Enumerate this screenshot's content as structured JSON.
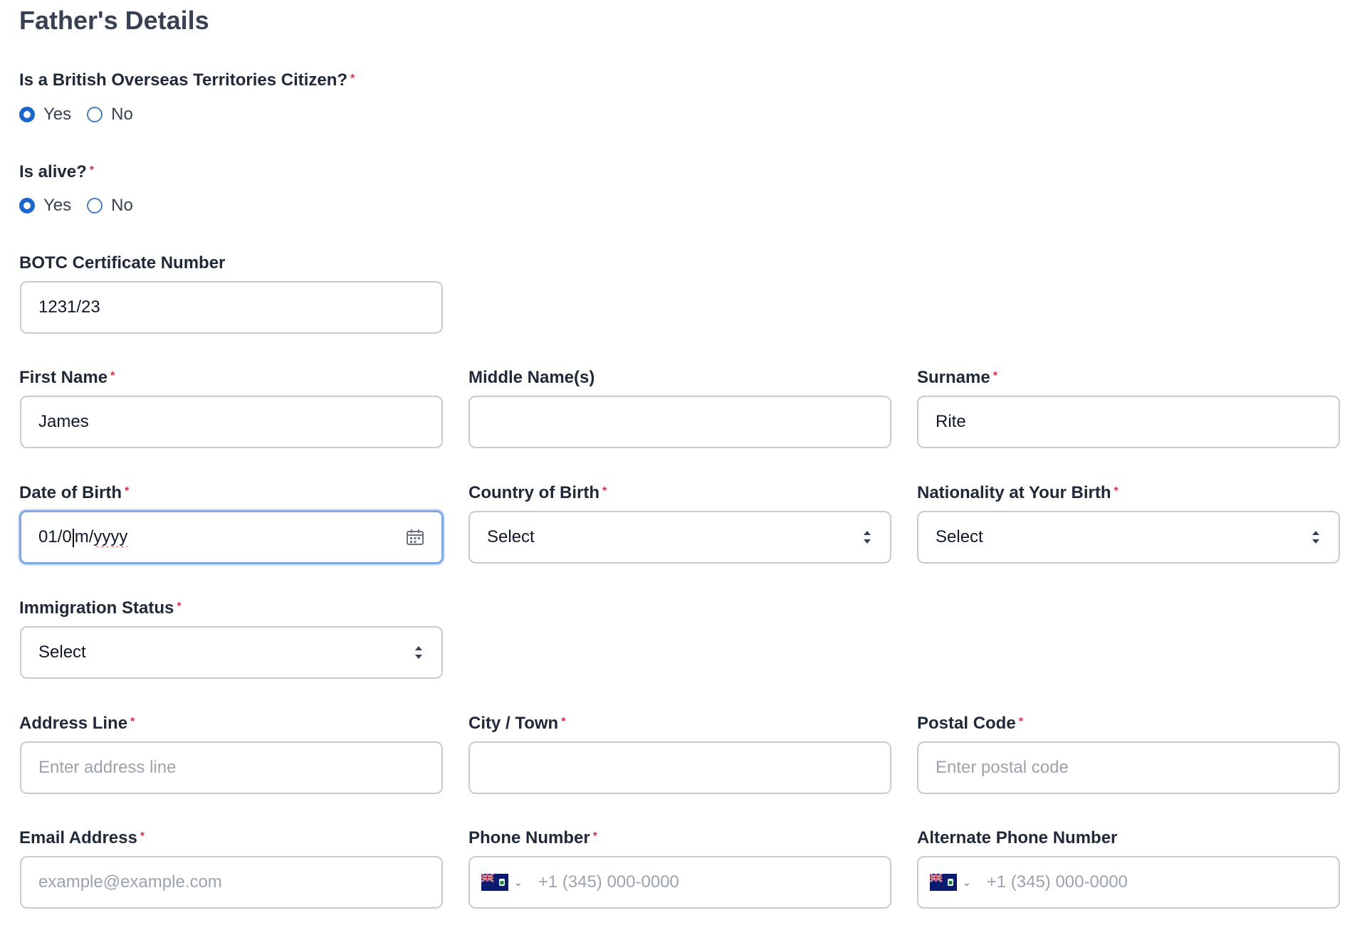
{
  "section_title": "Father's Details",
  "required_mark": "*",
  "citizen": {
    "label": "Is a British Overseas Territories Citizen?",
    "options": [
      "Yes",
      "No"
    ],
    "selected": "Yes"
  },
  "alive": {
    "label": "Is alive?",
    "options": [
      "Yes",
      "No"
    ],
    "selected": "Yes"
  },
  "botc": {
    "label": "BOTC Certificate Number",
    "value": "1231/23"
  },
  "first_name": {
    "label": "First Name",
    "value": "James"
  },
  "middle_name": {
    "label": "Middle Name(s)",
    "value": ""
  },
  "surname": {
    "label": "Surname",
    "value": "Rite"
  },
  "dob": {
    "label": "Date of Birth",
    "value_before_caret": "01/0",
    "value_after_caret": "m/",
    "value_misspelled": "yyyy",
    "icon": "calendar-icon"
  },
  "country_of_birth": {
    "label": "Country of Birth",
    "value": "Select"
  },
  "nationality_at_birth": {
    "label": "Nationality at Your Birth",
    "value": "Select"
  },
  "immigration_status": {
    "label": "Immigration Status",
    "value": "Select"
  },
  "address_line": {
    "label": "Address Line",
    "placeholder": "Enter address line"
  },
  "city_town": {
    "label": "City / Town",
    "placeholder": ""
  },
  "postal_code": {
    "label": "Postal Code",
    "placeholder": "Enter postal code"
  },
  "email": {
    "label": "Email Address",
    "placeholder": "example@example.com"
  },
  "phone": {
    "label": "Phone Number",
    "placeholder": "+1 (345) 000-0000",
    "flag_icon": "cayman-islands-flag-icon"
  },
  "alt_phone": {
    "label": "Alternate Phone Number",
    "placeholder": "+1 (345) 000-0000",
    "flag_icon": "cayman-islands-flag-icon"
  },
  "colors": {
    "accent": "#1a66cc",
    "required": "#d6334b",
    "border": "#c8ccd2",
    "focus_border": "#7fa7e6"
  }
}
